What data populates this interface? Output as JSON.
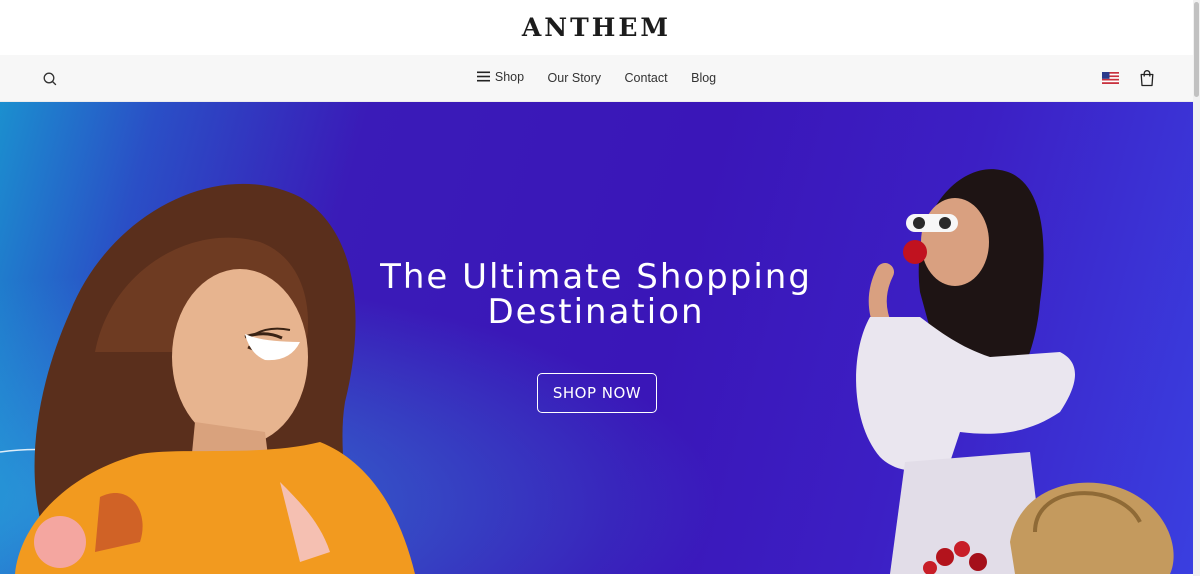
{
  "brand": {
    "logo_text": "ANTHEM"
  },
  "nav": {
    "search_icon": "search-icon",
    "links": [
      {
        "label": "Shop",
        "icon": "menu-icon"
      },
      {
        "label": "Our Story"
      },
      {
        "label": "Contact"
      },
      {
        "label": "Blog"
      }
    ],
    "locale_flag": "us-flag-icon",
    "cart_icon": "shopping-bag-icon"
  },
  "hero": {
    "title": "The Ultimate Shopping Destination",
    "cta_label": "SHOP NOW"
  },
  "colors": {
    "hero_primary": "#3a16b8",
    "hero_accent": "#1b8fcf",
    "navbar_bg": "#f7f7f7",
    "text_dark": "#1c1c1c"
  }
}
